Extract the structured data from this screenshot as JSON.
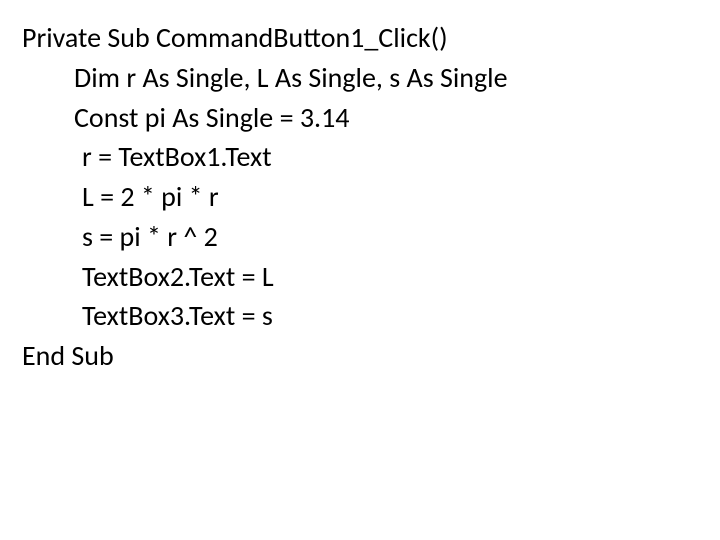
{
  "code": {
    "line1": "Private Sub CommandButton1_Click()",
    "line2": "Dim r As Single, L As Single, s As Single",
    "line3": "Const pi As Single = 3.14",
    "line4": "r = TextBox1.Text",
    "line5": "L = 2 * pi * r",
    "line6": "s = pi * r ^ 2",
    "line7": "TextBox2.Text = L",
    "line8": "TextBox3.Text = s",
    "line9": "End Sub"
  }
}
